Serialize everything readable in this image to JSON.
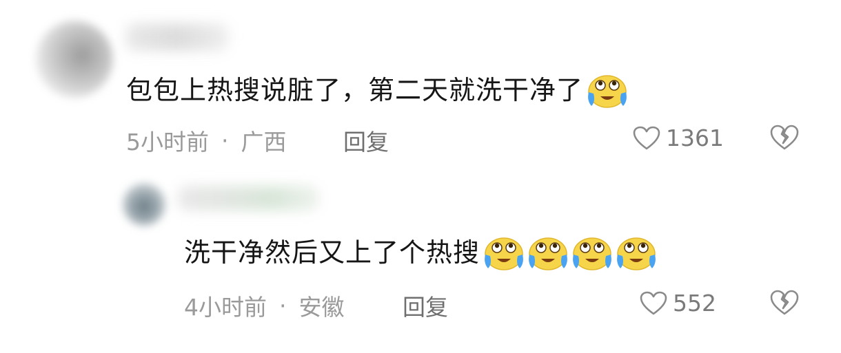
{
  "comments": [
    {
      "text": "包包上热搜说脏了，第二天就洗干净了",
      "emoji": [
        "crying-laughing-emoji"
      ],
      "time": "5小时前",
      "separator": "·",
      "location": "广西",
      "reply_label": "回复",
      "likes": "1361"
    },
    {
      "text": "洗干净然后又上了个热搜",
      "emoji": [
        "crying-laughing-emoji",
        "crying-laughing-emoji",
        "crying-laughing-emoji",
        "crying-laughing-emoji"
      ],
      "time": "4小时前",
      "separator": "·",
      "location": "安徽",
      "reply_label": "回复",
      "likes": "552"
    }
  ],
  "icons": {
    "like": "heart-outline-icon",
    "dislike": "broken-heart-icon",
    "emoji": "crying-laughing-emoji"
  },
  "colors": {
    "text": "#161616",
    "meta": "#9a9a9a",
    "reply": "#6f6f6f",
    "icon": "#8a8a8a",
    "emoji_face": "#f7d54a",
    "emoji_tear": "#4aa3f0"
  }
}
